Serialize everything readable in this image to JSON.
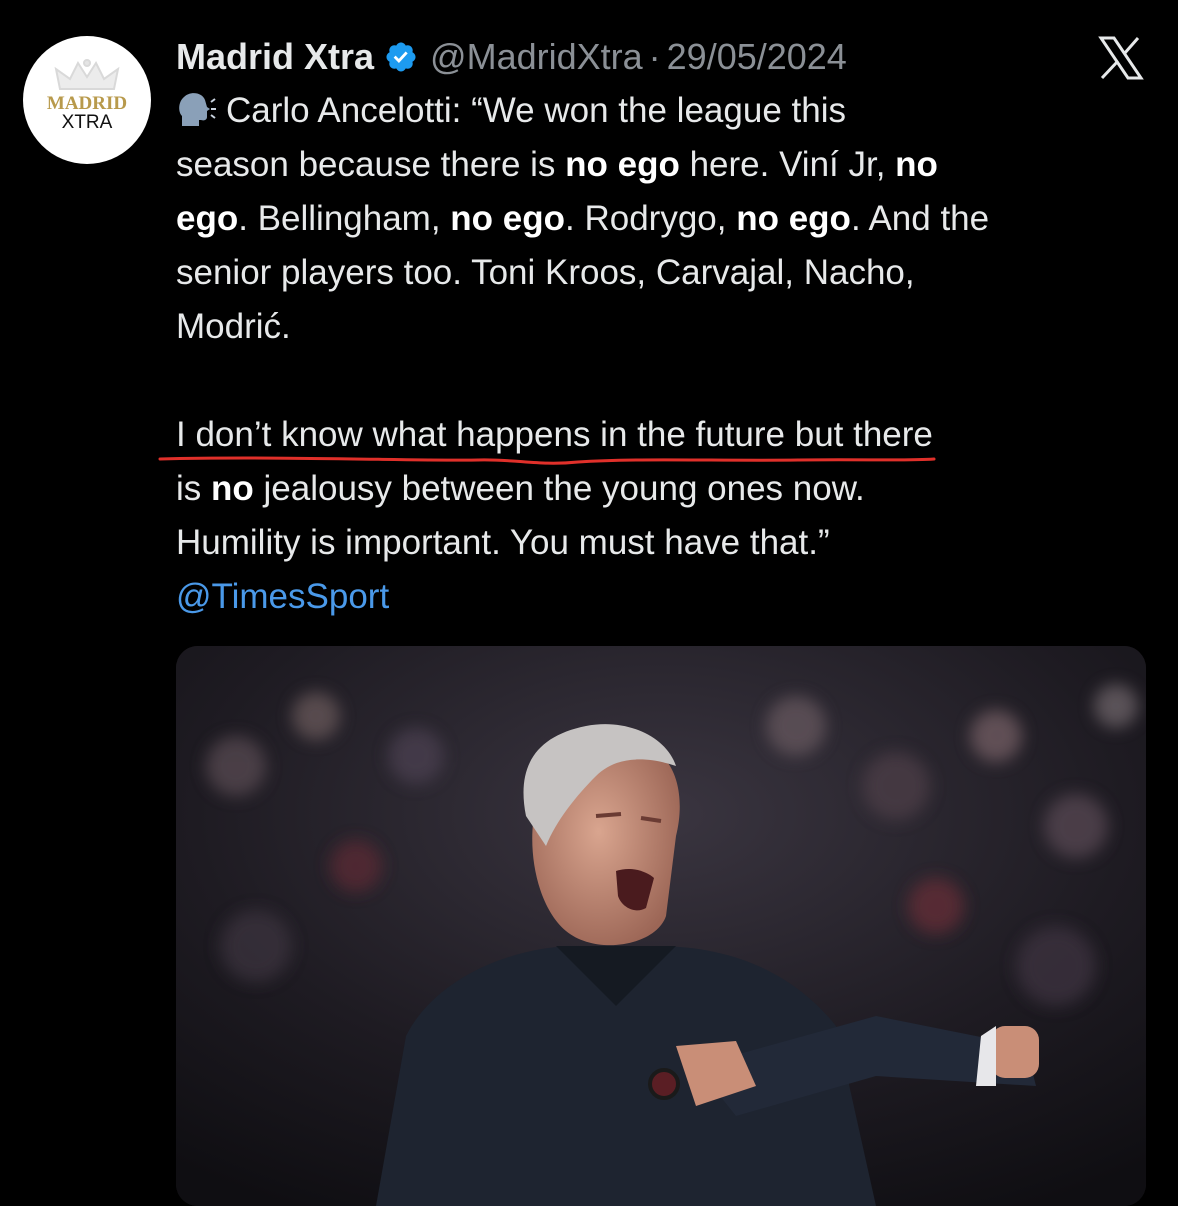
{
  "author": {
    "display_name": "Madrid Xtra",
    "handle": "@MadridXtra",
    "separator": "·",
    "date": "29/05/2024",
    "avatar_text_top": "MADRID",
    "avatar_text_bottom": "XTRA",
    "verified_icon": "verified-badge-icon"
  },
  "platform": {
    "logo": "x-logo-icon"
  },
  "tweet": {
    "emoji": "speaking-head-emoji",
    "line1_a": "Carlo Ancelotti: “We won the league this",
    "line2_a": "season because there is ",
    "line2_b": "no ego",
    "line2_c": " here. Viní Jr, ",
    "line2_d": "no",
    "line3_a": "ego",
    "line3_b": ". Bellingham, ",
    "line3_c": "no ego",
    "line3_d": ". Rodrygo, ",
    "line3_e": "no ego",
    "line3_f": ". And the",
    "line4": "senior players too. Toni Kroos, Carvajal, Nacho,",
    "line5": "Modrić.",
    "line6_underlined": "I don’t know what happens in the future",
    "line6_rest": " but there",
    "line7_a": "is ",
    "line7_b": "no",
    "line7_c": " jealousy between the young ones now.",
    "line8": "Humility is important. You must have that.”",
    "mention": "@TimesSport"
  },
  "colors": {
    "background": "#000000",
    "text": "#e7e9ea",
    "secondary_text": "#8b9096",
    "link": "#4a99e9",
    "verified": "#1d9bf0",
    "annotation_line": "#e0302a"
  },
  "media": {
    "type": "photo"
  }
}
